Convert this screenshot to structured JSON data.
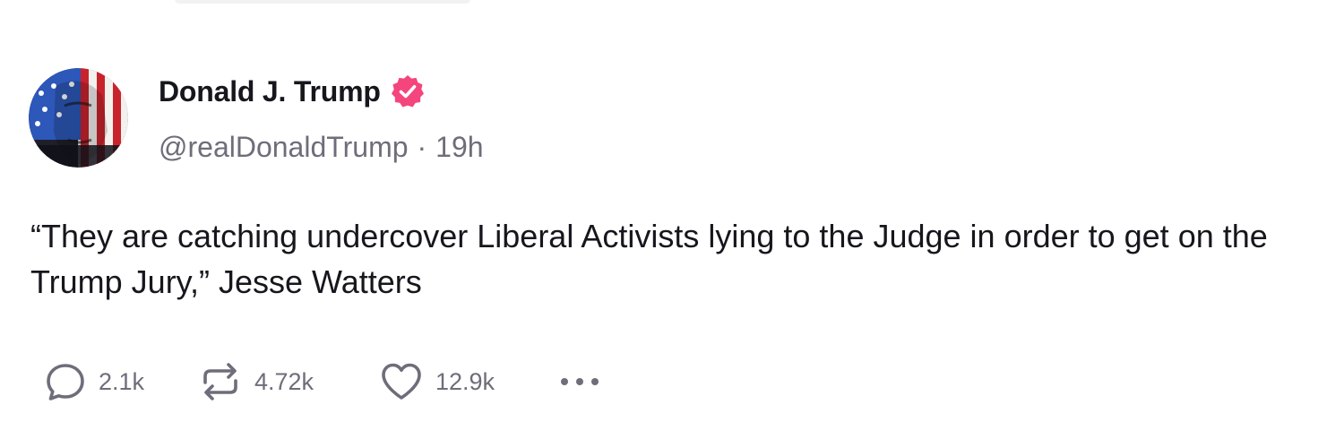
{
  "post": {
    "author": {
      "display_name": "Donald J. Trump",
      "handle": "@realDonaldTrump",
      "verified": true,
      "verified_color": "#f5457d"
    },
    "separator": "·",
    "timestamp": "19h",
    "text": "“They are catching undercover Liberal Activists lying to the Judge in order to get on the Trump Jury,” Jesse Watters",
    "actions": {
      "replies": "2.1k",
      "reposts": "4.72k",
      "likes": "12.9k",
      "more_icon": "ellipsis-icon"
    }
  },
  "colors": {
    "text_primary": "#16161d",
    "text_secondary": "#6e6d7a",
    "background": "#ffffff"
  }
}
